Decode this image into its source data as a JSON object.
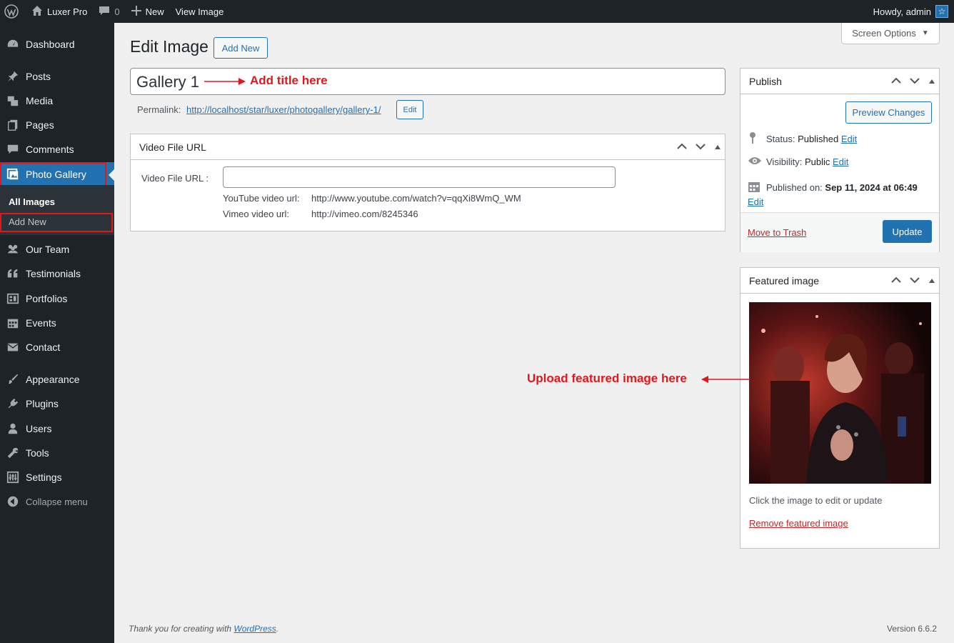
{
  "adminbar": {
    "site_name": "Luxer Pro",
    "comments_count": "0",
    "new_label": "New",
    "view_label": "View Image",
    "greeting": "Howdy, admin"
  },
  "sidebar": {
    "items": [
      {
        "label": "Dashboard"
      },
      {
        "label": "Posts"
      },
      {
        "label": "Media"
      },
      {
        "label": "Pages"
      },
      {
        "label": "Comments"
      },
      {
        "label": "Photo Gallery"
      },
      {
        "label": "Our Team"
      },
      {
        "label": "Testimonials"
      },
      {
        "label": "Portfolios"
      },
      {
        "label": "Events"
      },
      {
        "label": "Contact"
      },
      {
        "label": "Appearance"
      },
      {
        "label": "Plugins"
      },
      {
        "label": "Users"
      },
      {
        "label": "Tools"
      },
      {
        "label": "Settings"
      }
    ],
    "submenu": {
      "all": "All Images",
      "add_new": "Add New"
    },
    "collapse": "Collapse menu"
  },
  "header": {
    "title": "Edit Image",
    "add_new": "Add New",
    "screen_options": "Screen Options"
  },
  "post": {
    "title_value": "Gallery 1",
    "permalink_label": "Permalink:",
    "permalink_url": "http://localhost/star/luxer/photogallery/gallery-1/",
    "permalink_edit": "Edit"
  },
  "annotations": {
    "title_hint": "Add title here",
    "featured_hint": "Upload featured image here"
  },
  "video_box": {
    "title": "Video File URL",
    "field_label": "Video File URL :",
    "field_value": "",
    "youtube_label": "YouTube video url:",
    "youtube_example": "http://www.youtube.com/watch?v=qqXi8WmQ_WM",
    "vimeo_label": "Vimeo video url:",
    "vimeo_example": "http://vimeo.com/8245346"
  },
  "publish": {
    "title": "Publish",
    "preview": "Preview Changes",
    "status_label": "Status:",
    "status_value": "Published",
    "visibility_label": "Visibility:",
    "visibility_value": "Public",
    "published_label": "Published on:",
    "published_value": "Sep 11, 2024 at 06:49",
    "edit": "Edit",
    "trash": "Move to Trash",
    "update": "Update"
  },
  "featured": {
    "title": "Featured image",
    "hint": "Click the image to edit or update",
    "remove": "Remove featured image"
  },
  "footer": {
    "thanks_prefix": "Thank you for creating with",
    "thanks_link": "WordPress",
    "thanks_suffix": ".",
    "version": "Version 6.6.2"
  }
}
